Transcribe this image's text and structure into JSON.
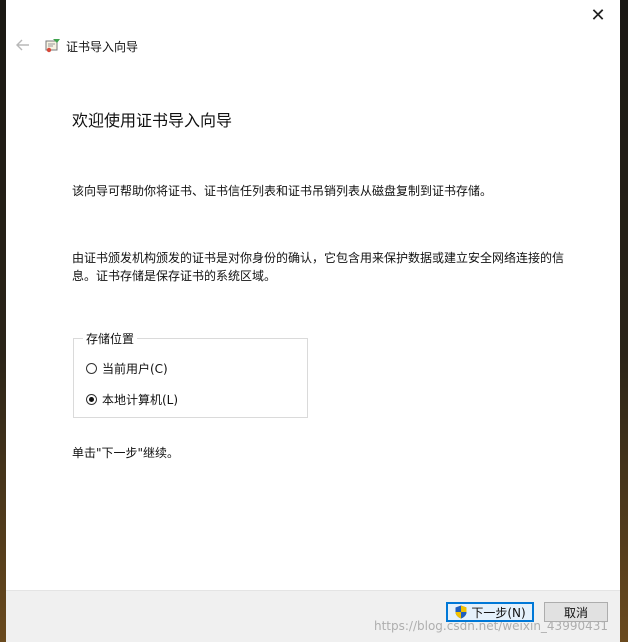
{
  "window": {
    "close_symbol": "✕"
  },
  "header": {
    "back_icon": "arrow-left-icon",
    "wizard_icon": "certificate-icon",
    "title": "证书导入向导"
  },
  "main": {
    "page_title": "欢迎使用证书导入向导",
    "paragraph1": "该向导可帮助你将证书、证书信任列表和证书吊销列表从磁盘复制到证书存储。",
    "paragraph2": "由证书颁发机构颁发的证书是对你身份的确认，它包含用来保护数据或建立安全网络连接的信息。证书存储是保存证书的系统区域。",
    "store_location": {
      "label": "存储位置",
      "options": [
        {
          "label": "当前用户(C)",
          "checked": false
        },
        {
          "label": "本地计算机(L)",
          "checked": true
        }
      ]
    },
    "continue_hint": "单击\"下一步\"继续。"
  },
  "footer": {
    "next_label": "下一步(N)",
    "next_icon": "uac-shield-icon",
    "cancel_label": "取消"
  },
  "watermark": "https://blog.csdn.net/weixin_43990431",
  "colors": {
    "accent": "#0078d7",
    "footer_bg": "#f0f0f0"
  }
}
